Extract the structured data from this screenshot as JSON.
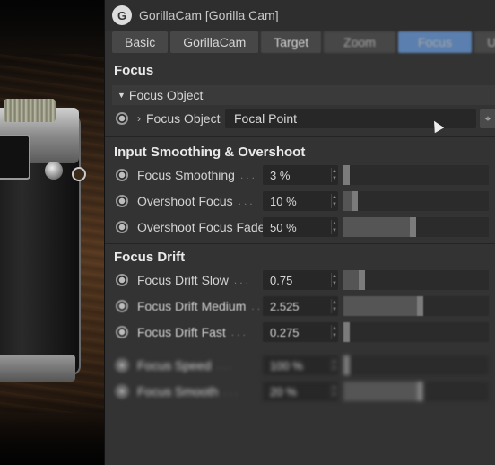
{
  "window": {
    "logo_glyph": "G",
    "title": "GorillaCam [Gorilla Cam]"
  },
  "tabs": [
    {
      "label": "Basic"
    },
    {
      "label": "GorillaCam"
    },
    {
      "label": "Target"
    },
    {
      "label": "Zoom"
    },
    {
      "label": "Focus"
    },
    {
      "label": "U"
    }
  ],
  "focus_section": {
    "title": "Focus",
    "group_label": "Focus Object",
    "object_label": "Focus Object",
    "object_value": "Focal Point"
  },
  "smoothing_section": {
    "title": "Input Smoothing & Overshoot",
    "rows": [
      {
        "label": "Focus Smoothing",
        "value": "3 %",
        "fraction": 0.03
      },
      {
        "label": "Overshoot Focus",
        "value": "10 %",
        "fraction": 0.1
      },
      {
        "label": "Overshoot Focus Fade",
        "value": "50 %",
        "fraction": 0.5
      }
    ]
  },
  "drift_section": {
    "title": "Focus Drift",
    "rows": [
      {
        "label": "Focus Drift Slow",
        "value": "0.75",
        "fraction": 0.15
      },
      {
        "label": "Focus Drift Medium",
        "value": "2.525",
        "fraction": 0.55
      },
      {
        "label": "Focus Drift Fast",
        "value": "0.275",
        "fraction": 0.03
      },
      {
        "label": "Focus Speed",
        "value": "100 %",
        "fraction": 0.02
      },
      {
        "label": "Focus Smooth",
        "value": "20 %",
        "fraction": 0.55
      }
    ]
  },
  "icons": {
    "radio": "radio-button-icon",
    "expand": "triangle-down-icon",
    "chevron": "chevron-right-icon",
    "pick": "link-pick-icon"
  },
  "colors": {
    "active_tab": "#5b7fae",
    "panel_bg": "#333333"
  }
}
